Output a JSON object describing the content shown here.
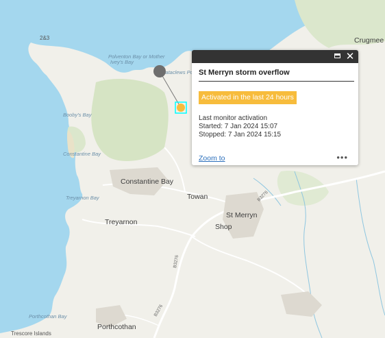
{
  "map": {
    "places": {
      "crugmeer": "Crugmee",
      "constantine_bay": "Constantine Bay",
      "towan": "Towan",
      "st_merryn": "St Merryn",
      "shop": "Shop",
      "treyarnon": "Treyarnon",
      "porthcothan": "Porthcothan",
      "two_and_three": "2&3",
      "trescore_islands": "Trescore Islands"
    },
    "water": {
      "polventon": "Polventon Bay or Mother",
      "polventon2": "Ivey's Bay",
      "cataclews": "Cataclews Point",
      "boobys": "Booby's Bay",
      "constantine_bay_sea": "Constantine Bay",
      "treyarnon_bay": "Treyarnon Bay",
      "porthcothan_bay": "Porthcothan Bay"
    },
    "roads": {
      "b3276_a": "B3276",
      "b3276_b": "B3276",
      "b3276_c": "B3276"
    },
    "colors": {
      "sea": "#a4d7ee",
      "land": "#f1f0ea",
      "green": "#d6e4c4",
      "marker": "#f7bc3c",
      "highlight": "#00ffff"
    }
  },
  "popup": {
    "title": "St Merryn storm overflow",
    "status": "Activated in the last 24 hours",
    "detail_heading": "Last monitor activation",
    "started": "Started: 7 Jan 2024 15:07",
    "stopped": "Stopped: 7 Jan 2024 15:15",
    "zoom_link": "Zoom to",
    "more_label": "•••",
    "close_label": "✕",
    "maximize_icon": "maximize-icon"
  }
}
